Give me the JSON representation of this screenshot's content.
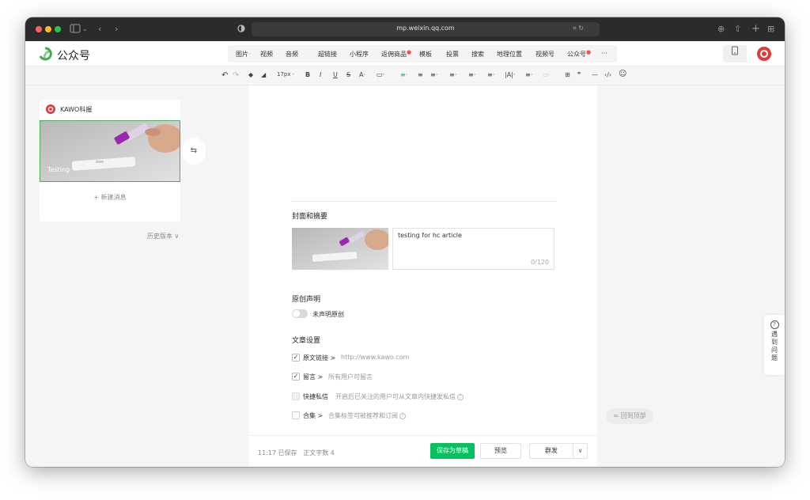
{
  "browser": {
    "url": "mp.weixin.qq.com",
    "icons": [
      "sidebar-icon",
      "back-icon",
      "forward-icon",
      "shield-icon",
      "translate-icon",
      "reload-icon",
      "download-icon",
      "share-icon",
      "new-tab-icon",
      "tab-overview-icon"
    ]
  },
  "header": {
    "brand": "公众号",
    "insert_items": [
      {
        "label": "图片",
        "has_caret": true
      },
      {
        "label": "视频"
      },
      {
        "label": "音频"
      },
      {
        "label": "超链接"
      },
      {
        "label": "小程序"
      },
      {
        "label": "返佣商品",
        "has_dot": true
      },
      {
        "label": "模板"
      },
      {
        "label": "投票"
      },
      {
        "label": "搜索"
      },
      {
        "label": "地理位置"
      },
      {
        "label": "视频号"
      },
      {
        "label": "公众号",
        "has_dot": true
      },
      {
        "label": "···"
      }
    ],
    "caret": "·",
    "dot": "●"
  },
  "toolbar": {
    "undo": "↶",
    "redo": "↷",
    "format_painter": "◆",
    "clear_format": "◢",
    "font_size": "17px",
    "font_size_caret": "·",
    "bold": "B",
    "italic": "I",
    "underline": "U",
    "strike": "S",
    "font_color": "A·",
    "bg_color": "▭·",
    "align_left": "≡·",
    "align_center": "≡",
    "indent": "≡·",
    "line_spacing": "≡·",
    "para_spacing": "≡·",
    "list": "≡·",
    "letter_spacing": "|A|·",
    "ordered_list": "≡·",
    "bullet_list": "▭·",
    "table": "⊞",
    "quote": "❞",
    "hr": "—",
    "code": "‹/›",
    "emoji": "☺"
  },
  "sidebar": {
    "account_name": "KAWO科握",
    "article_title": "Testing",
    "new_message": "+ 新建消息",
    "swap": "⇆",
    "history": "历史版本 ∨"
  },
  "editor": {
    "cover_title": "封面和摘要",
    "summary_text": "testing for hc article",
    "summary_count": "0/120",
    "original_title": "原创声明",
    "original_label": "未声明原创",
    "settings_title": "文章设置",
    "settings": [
      {
        "label": "原文链接 >",
        "hint": "http://www.kawo.com",
        "checked": true
      },
      {
        "label": "留言 >",
        "hint": "所有用户可留言",
        "checked": true
      },
      {
        "label": "快捷私信",
        "hint": "开启后已关注的用户可从文章内快捷发私信",
        "checked": false,
        "info": true
      },
      {
        "label": "合集 >",
        "hint": "合集标签可被推荐和订阅",
        "checked": false,
        "info": true
      }
    ],
    "check_mark": "✓",
    "info_mark": "!"
  },
  "bottom": {
    "status": "11:17 已保存",
    "word_count": "正文字数 4",
    "save_draft": "保存为草稿",
    "preview": "预览",
    "publish": "群发",
    "publish_caret": "∨"
  },
  "back_to_top": "≈ 回到顶部",
  "help": {
    "icon": "?",
    "text": "遇到问题"
  },
  "colors": {
    "accent_green": "#07c160",
    "toolbar_green": "#4fae5a",
    "brand_red": "#e0393e"
  }
}
